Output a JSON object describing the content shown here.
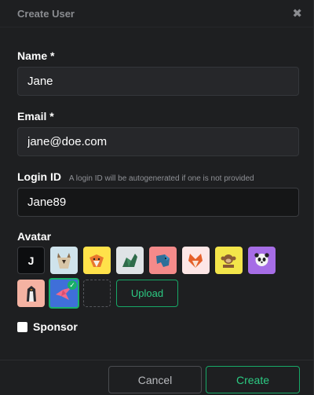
{
  "dialog": {
    "title": "Create User",
    "close_icon": "close-icon"
  },
  "fields": {
    "name": {
      "label": "Name *",
      "value": "Jane"
    },
    "email": {
      "label": "Email *",
      "value": "jane@doe.com"
    },
    "login_id": {
      "label": "Login ID",
      "hint": "A login ID will be autogenerated if one is not provided",
      "value": "Jane89"
    }
  },
  "avatar": {
    "label": "Avatar",
    "initial": "J",
    "options": [
      "cat-avatar",
      "fox-dog-avatar",
      "dinosaur-avatar",
      "elephant-avatar",
      "fox-avatar",
      "monkey-avatar",
      "panda-avatar",
      "penguin-avatar",
      "bird-avatar"
    ],
    "selected": "bird-avatar",
    "upload_label": "Upload"
  },
  "sponsor": {
    "label": "Sponsor",
    "checked": false
  },
  "footer": {
    "cancel_label": "Cancel",
    "create_label": "Create"
  },
  "colors": {
    "accent": "#17a867",
    "background": "#1e1f21",
    "input": "#26272a"
  }
}
